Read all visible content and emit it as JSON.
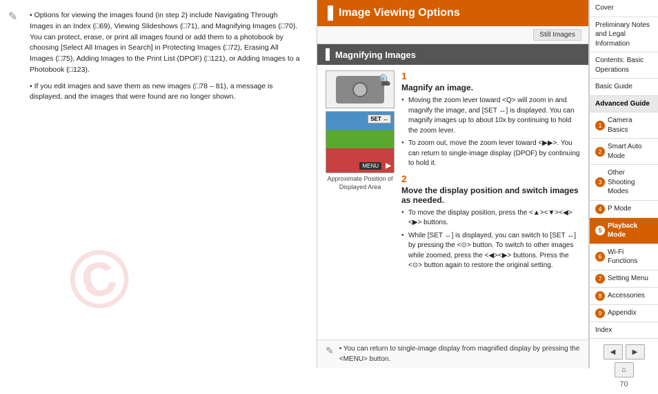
{
  "leftPanel": {
    "noteIcon": "✎",
    "paragraphs": [
      "• Options for viewing the images found (in step 2) include Navigating Through Images in an Index (□69), Viewing Slideshows (□71), and Magnifying Images (□70). You can protect, erase, or print all images found or add them to a photobook by choosing [Select All Images in Search] in Protecting Images (□72), Erasing All Images (□75), Adding Images to the Print List (DPOF) (□121), or Adding Images to a Photobook (□123).",
      "• If you edit images and save them as new images (□78 – 81), a message is displayed, and the images that were found are no longer shown."
    ]
  },
  "middlePanel": {
    "title": "Image Viewing Options",
    "stillImagesLabel": "Still Images",
    "sectionTitle": "Magnifying Images",
    "step1": {
      "number": "1",
      "title": "Magnify an image.",
      "bullets": [
        "Moving the zoom lever toward <Q> will zoom in and magnify the image, and [SET ↔] is displayed. You can magnify images up to about 10x by continuing to hold the zoom lever.",
        "To zoom out, move the zoom lever toward <▶▶>. You can return to single-image display (DPOF) by continuing to hold it."
      ]
    },
    "step2": {
      "number": "2",
      "title": "Move the display position and switch images as needed.",
      "bullets": [
        "To move the display position, press the <▲><▼><◀><▶> buttons.",
        "While [SET ↔] is displayed, you can switch to [SET ↔] by pressing the <⊙> button. To switch to other images while zoomed, press the <◀><▶> buttons. Press the <⊙> button again to restore the original setting."
      ]
    },
    "caption": "Approximate Position\nof Displayed Area",
    "note": "• You can return to single-image display from magnified display by pressing the <MENU> button."
  },
  "rightPanel": {
    "items": [
      {
        "id": "cover",
        "label": "Cover",
        "type": "plain"
      },
      {
        "id": "prelim",
        "label": "Preliminary Notes and Legal Information",
        "type": "plain"
      },
      {
        "id": "contents",
        "label": "Contents: Basic Operations",
        "type": "plain"
      },
      {
        "id": "basic-guide",
        "label": "Basic Guide",
        "type": "plain"
      },
      {
        "id": "advanced-guide",
        "label": "Advanced Guide",
        "type": "header"
      },
      {
        "id": "camera-basics",
        "label": "Camera Basics",
        "num": "1",
        "type": "numbered"
      },
      {
        "id": "smart-auto",
        "label": "Smart Auto Mode",
        "num": "2",
        "type": "numbered"
      },
      {
        "id": "other-shooting",
        "label": "Other Shooting Modes",
        "num": "3",
        "type": "numbered"
      },
      {
        "id": "p-mode",
        "label": "P Mode",
        "num": "4",
        "type": "numbered"
      },
      {
        "id": "playback-mode",
        "label": "Playback Mode",
        "num": "5",
        "type": "numbered",
        "active": true
      },
      {
        "id": "wifi",
        "label": "Wi-Fi Functions",
        "num": "6",
        "type": "numbered"
      },
      {
        "id": "setting-menu",
        "label": "Setting Menu",
        "num": "7",
        "type": "numbered"
      },
      {
        "id": "accessories",
        "label": "Accessories",
        "num": "8",
        "type": "numbered"
      },
      {
        "id": "appendix",
        "label": "Appendix",
        "num": "9",
        "type": "numbered"
      },
      {
        "id": "index",
        "label": "Index",
        "type": "plain"
      }
    ],
    "prevLabel": "◀",
    "nextLabel": "▶",
    "homeLabel": "⌂",
    "pageNumber": "70"
  }
}
